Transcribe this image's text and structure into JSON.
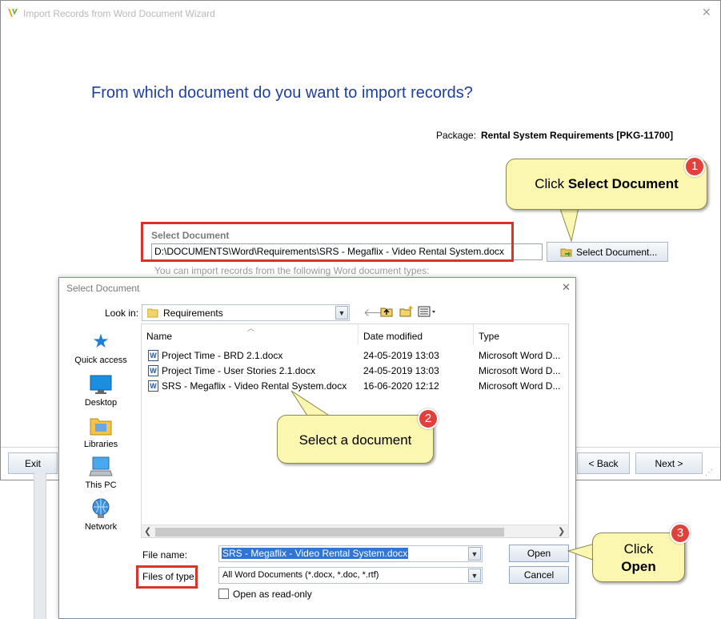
{
  "wizard": {
    "title": "Import Records from Word Document Wizard",
    "heading": "From which document do you want to import records?",
    "package_label": "Package:",
    "package_value": "Rental System Requirements [PKG-11700]",
    "select_document_label": "Select Document",
    "document_path": "D:\\DOCUMENTS\\Word\\Requirements\\SRS - Megaflix - Video Rental System.docx",
    "select_document_button": "Select Document...",
    "hint": "You can import records from the following Word document types:",
    "exit_button": "Exit",
    "back_button": "< Back",
    "next_button": "Next >"
  },
  "dialog": {
    "title": "Select Document",
    "look_in_label": "Look in:",
    "look_in_value": "Requirements",
    "places": [
      "Quick access",
      "Desktop",
      "Libraries",
      "This PC",
      "Network"
    ],
    "columns": [
      "Name",
      "Date modified",
      "Type"
    ],
    "files": [
      {
        "name": "Project Time - BRD 2.1.docx",
        "date": "24-05-2019 13:03",
        "type": "Microsoft Word D..."
      },
      {
        "name": "Project Time - User Stories 2.1.docx",
        "date": "24-05-2019 13:03",
        "type": "Microsoft Word D..."
      },
      {
        "name": "SRS - Megaflix - Video Rental System.docx",
        "date": "16-06-2020 12:12",
        "type": "Microsoft Word D..."
      }
    ],
    "file_name_label": "File name:",
    "file_name_value": "SRS - Megaflix - Video Rental System.docx",
    "files_of_type_label": "Files of type:",
    "files_of_type_value": "All Word Documents (*.docx, *.doc, *.rtf)",
    "open_readonly_label": "Open as read-only",
    "open_button": "Open",
    "cancel_button": "Cancel"
  },
  "callouts": {
    "c1_prefix": "Click ",
    "c1_bold": "Select Document",
    "c2": "Select a document",
    "c3_line1": "Click",
    "c3_line2": "Open",
    "badge1": "1",
    "badge2": "2",
    "badge3": "3"
  },
  "colors": {
    "heading": "#1f3f9f",
    "callout_fill": "#fbf6b0",
    "annotation_red": "#d9342b",
    "badge_red": "#e0413a",
    "selection_blue": "#3074d4"
  }
}
